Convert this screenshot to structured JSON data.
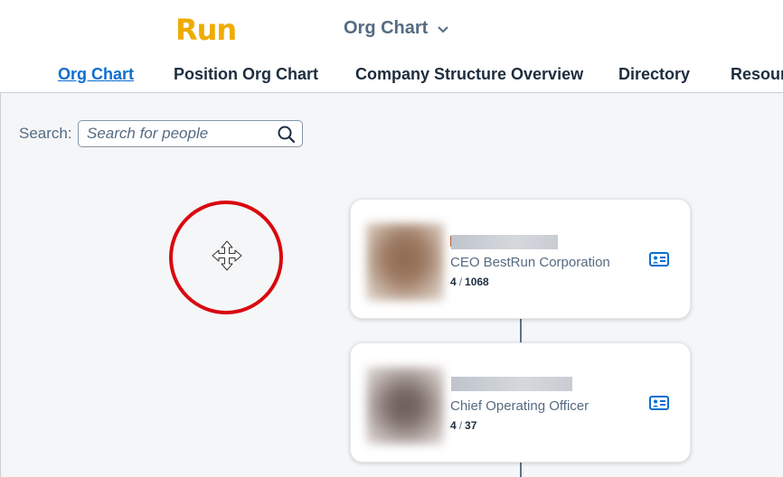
{
  "header": {
    "logo_text": "Run",
    "app_title": "Org Chart",
    "nav": [
      {
        "label": "Org Chart",
        "active": true
      },
      {
        "label": "Position Org Chart",
        "active": false
      },
      {
        "label": "Company Structure Overview",
        "active": false
      },
      {
        "label": "Directory",
        "active": false
      },
      {
        "label": "Resour",
        "active": false
      }
    ]
  },
  "search": {
    "label": "Search:",
    "placeholder": "Search for people"
  },
  "cards": [
    {
      "title": "CEO BestRun Corporation",
      "direct_reports": "4",
      "separator": "/",
      "total_reports": "1068"
    },
    {
      "title": "Chief Operating Officer",
      "direct_reports": "4",
      "separator": "/",
      "total_reports": "37"
    }
  ],
  "colors": {
    "brand": "#f0ab00",
    "link": "#0a6ed1",
    "highlight": "#d9070f"
  }
}
